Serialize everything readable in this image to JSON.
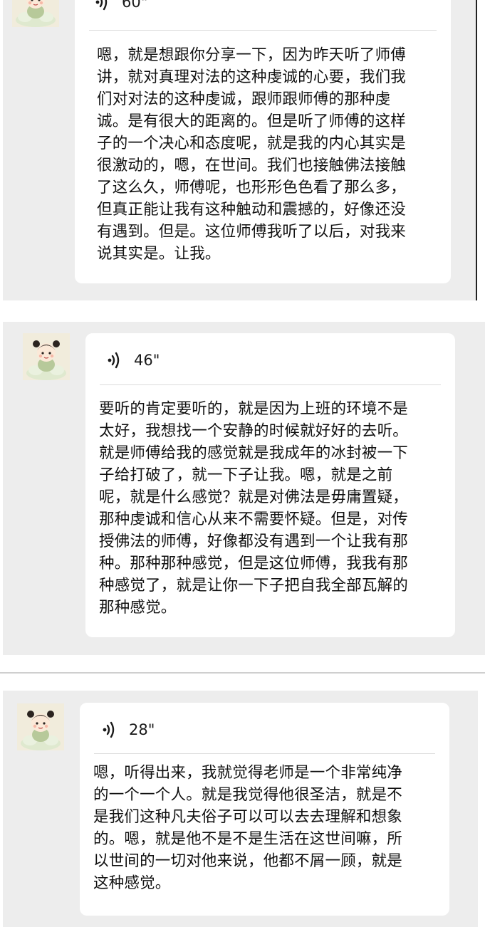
{
  "messages": [
    {
      "duration": "60\"",
      "transcript": "嗯，就是想跟你分享一下，因为昨天听了师傅\n讲，就对真理对法的这种虔诚的心要，我们我\n们对对法的这种虔诚，跟师跟师傅的那种虔\n诚。是有很大的距离的。但是听了师傅的这样\n子的一个决心和态度呢，就是我的内心其实是\n很激动的，嗯，在世间。我们也接触佛法接触\n了这么久，师傅呢，也形形色色看了那么多，\n但真正能让我有这种触动和震撼的，好像还没\n有遇到。但是。这位师傅我听了以后，对我来\n说其实是。让我。"
    },
    {
      "duration": "46\"",
      "transcript": "要听的肯定要听的，就是因为上班的环境不是\n太好，我想找一个安静的时候就好好的去听。\n就是师傅给我的感觉就是我成年的冰封被一下\n子给打破了，就一下子让我。嗯，就是之前\n呢，就是什么感觉？就是对佛法是毋庸置疑，\n那种虔诚和信心从来不需要怀疑。但是，对传\n授佛法的师傅，好像都没有遇到一个让我有那\n种。那种那种感觉，但是这位师傅，我我有那\n种感觉了，就是让你一下子把自我全部瓦解的\n那种感觉。"
    },
    {
      "duration": "28\"",
      "transcript": "嗯，听得出来，我就觉得老师是一个非常纯净\n的一个一个人。就是我觉得他很圣洁，就是不\n是我们这种凡夫俗子可以可以去去理解和想象\n的。嗯，就是他不是不是生活在这世间嘛，所\n以世间的一切对他来说，他都不屑一顾，就是\n这种感觉。"
    }
  ],
  "icons": {
    "voice": "voice-wave-icon",
    "avatar": "cartoon-girl-avatar"
  },
  "colors": {
    "panel_bg": "#ededed",
    "bubble_bg": "#ffffff",
    "text": "#111111"
  }
}
